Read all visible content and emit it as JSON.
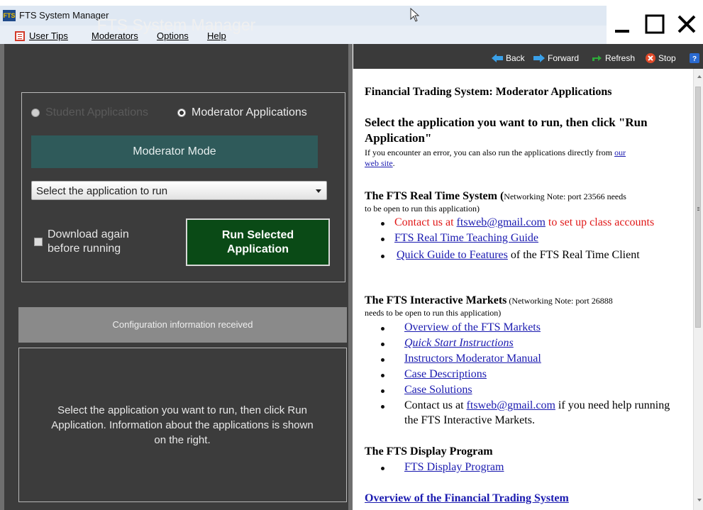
{
  "window": {
    "title": "FTS System Manager",
    "icon_text": "FTS"
  },
  "menu": {
    "user_tips": "User Tips",
    "moderators": "Moderators",
    "options": "Options",
    "help": "Help"
  },
  "left": {
    "title": "FTS System Manager",
    "radio_student": "Student Applications",
    "radio_moderator": "Moderator Applications",
    "mode_label": "Moderator Mode",
    "select_value": "Select the application to run",
    "checkbox_line1": "Download again",
    "checkbox_line2": "before running",
    "run_line1": "Run Selected",
    "run_line2": "Application",
    "config_status": "Configuration information received",
    "info_line1": "Select the application you want to run, then click Run",
    "info_line2": "Application.  Information about the applications is shown",
    "info_line3": "on the right."
  },
  "browser": {
    "back": "Back",
    "forward": "Forward",
    "refresh": "Refresh",
    "stop": "Stop"
  },
  "content": {
    "heading": "Financial Trading System: Moderator Applications",
    "select_line1": "Select the application you want to run, then click \"Run",
    "select_line2": "Application\"",
    "error_pre": "If you encounter an error, you can also run the applications directly from",
    "error_link1": "our",
    "error_link2": "web site",
    "error_post": ".",
    "rt_title": "The FTS Real Time System",
    "rt_note_a": " (",
    "rt_note_b": "Networking Note: port 23566 needs",
    "rt_note_c": "to be open to run this application)",
    "rt_contact_pre": "Contact us at ",
    "rt_contact_email": "ftsweb@gmail.com",
    "rt_contact_post": " to set up class accounts",
    "rt_guide": "FTS Real Time Teaching Guide",
    "rt_quick_link": "Quick Guide to Features",
    "rt_quick_post": " of the FTS Real Time Client",
    "im_title": "The FTS Interactive Markets",
    "im_note_a": " (Networking Note:  port 26888",
    "im_note_b": "needs to be open to run this application)",
    "im_links": [
      "Overview of the FTS Markets",
      "Quick Start Instructions",
      "Instructors Moderator Manual",
      "Case Descriptions",
      "Case Solutions"
    ],
    "im_contact_pre": "Contact us at ",
    "im_contact_email": "ftsweb@gmail.com",
    "im_contact_post": " if you need help running",
    "im_contact_line2": "the FTS Interactive Markets.",
    "dp_title": "The FTS Display Program",
    "dp_link": "FTS Display Program",
    "overview_link": "Overview of the Financial Trading System"
  }
}
